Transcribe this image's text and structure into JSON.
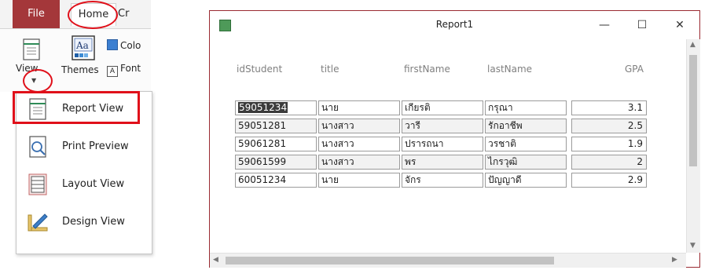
{
  "ribbon": {
    "tabs": {
      "file": "File",
      "home": "Home",
      "next_partial": "Cr"
    },
    "view_label": "View",
    "themes_label": "Themes",
    "colors_label": "Colo",
    "fonts_label": "Font"
  },
  "view_menu": {
    "items": [
      {
        "label": "Report View",
        "icon": "report-view-icon"
      },
      {
        "label": "Print Preview",
        "icon": "print-preview-icon"
      },
      {
        "label": "Layout View",
        "icon": "layout-view-icon"
      },
      {
        "label": "Design View",
        "icon": "design-view-icon"
      }
    ]
  },
  "window": {
    "title": "Report1",
    "minimize": "—",
    "maximize": "☐",
    "close": "✕"
  },
  "report": {
    "columns": [
      "idStudent",
      "title",
      "firstName",
      "lastName",
      "GPA"
    ],
    "rows": [
      [
        "59051234",
        "นาย",
        "เกียรติ",
        "กรุณา",
        "3.1"
      ],
      [
        "59051281",
        "นางสาว",
        "วารี",
        "รักอาชีพ",
        "2.5"
      ],
      [
        "59061281",
        "นางสาว",
        "ปรารถนา",
        "วรชาติ",
        "1.9"
      ],
      [
        "59061599",
        "นางสาว",
        "พร",
        "ไกรวุฒิ",
        "2"
      ],
      [
        "60051234",
        "นาย",
        "จักร",
        "ปัญญาดี",
        "2.9"
      ]
    ]
  },
  "colors": {
    "file_tab": "#a4373a",
    "highlight": "#e0101a",
    "window_border": "#9a2a31"
  }
}
